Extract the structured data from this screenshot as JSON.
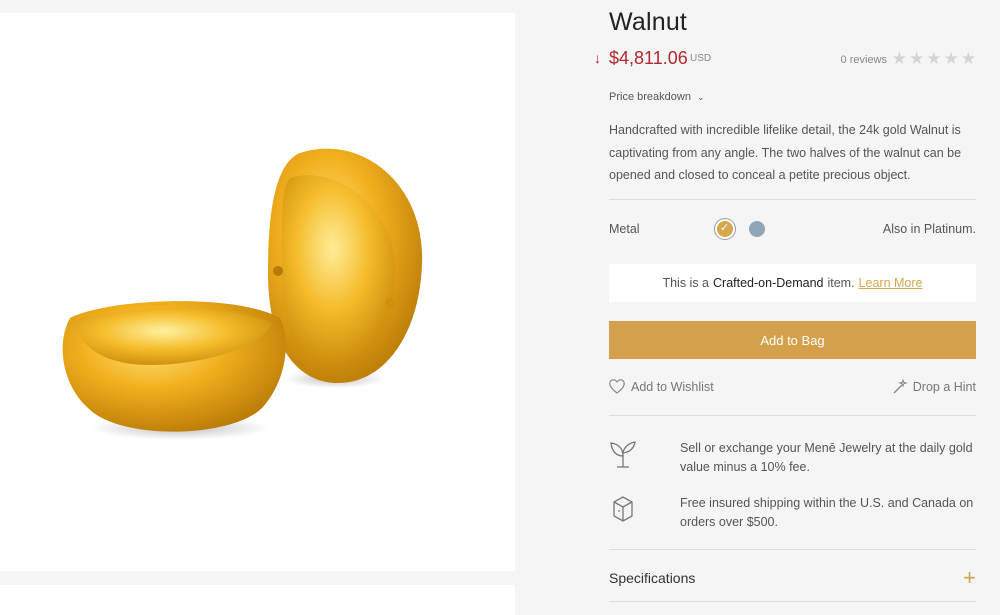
{
  "product": {
    "title": "Walnut",
    "price_arrow": "↓",
    "price": "$4,811.06",
    "currency": "USD",
    "reviews": "0 reviews",
    "rating_stars": 0,
    "rating_max": 5,
    "price_breakdown_label": "Price breakdown",
    "description": "Handcrafted with incredible lifelike detail, the 24k gold Walnut is captivating from any angle. The two halves of the walnut can be opened and closed to conceal a petite precious object."
  },
  "metal": {
    "label": "Metal",
    "options": [
      {
        "name": "Gold",
        "color": "#d4a84b",
        "selected": true
      },
      {
        "name": "Platinum",
        "color": "#8fa6b8",
        "selected": false
      }
    ],
    "also_in": "Also in Platinum."
  },
  "crafted": {
    "prefix": "This is a",
    "strong": "Crafted-on-Demand",
    "suffix": "item.",
    "link": "Learn More"
  },
  "actions": {
    "add_to_bag": "Add to Bag",
    "wishlist": "Add to Wishlist",
    "drop_hint": "Drop a Hint"
  },
  "perks": [
    {
      "icon": "plant-sprout-icon",
      "text": "Sell or exchange your Menē Jewelry at the daily gold value minus a 10% fee."
    },
    {
      "icon": "shipping-box-icon",
      "text": "Free insured shipping within the U.S. and Canada on orders over $500."
    }
  ],
  "specifications": {
    "label": "Specifications"
  },
  "colors": {
    "accent_gold": "#d4a04b",
    "price_red": "#b0282f",
    "star_gray": "#d4d4d4"
  }
}
